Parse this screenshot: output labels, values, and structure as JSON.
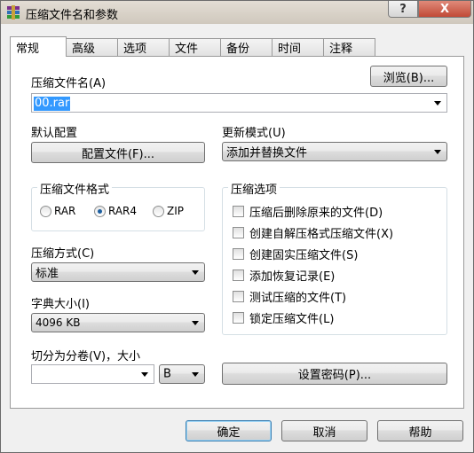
{
  "window": {
    "title": "压缩文件名和参数",
    "help_button": "?",
    "close_button": "X"
  },
  "tabs": [
    "常规",
    "高级",
    "选项",
    "文件",
    "备份",
    "时间",
    "注释"
  ],
  "archive_name": {
    "label": "压缩文件名(A)",
    "browse_button": "浏览(B)...",
    "value": "00.rar"
  },
  "profile": {
    "label": "默认配置",
    "button": "配置文件(F)..."
  },
  "update_mode": {
    "label": "更新模式(U)",
    "value": "添加并替换文件"
  },
  "format": {
    "title": "压缩文件格式",
    "options": [
      "RAR",
      "RAR4",
      "ZIP"
    ],
    "selected": "RAR4"
  },
  "method": {
    "label": "压缩方式(C)",
    "value": "标准"
  },
  "dictionary": {
    "label": "字典大小(I)",
    "value": "4096 KB"
  },
  "split": {
    "label": "切分为分卷(V)，大小",
    "value": "",
    "unit": "B"
  },
  "options": {
    "title": "压缩选项",
    "items": [
      "压缩后删除原来的文件(D)",
      "创建自解压格式压缩文件(X)",
      "创建固实压缩文件(S)",
      "添加恢复记录(E)",
      "测试压缩的文件(T)",
      "锁定压缩文件(L)"
    ]
  },
  "password_button": "设置密码(P)...",
  "footer": {
    "ok": "确定",
    "cancel": "取消",
    "help": "帮助"
  }
}
